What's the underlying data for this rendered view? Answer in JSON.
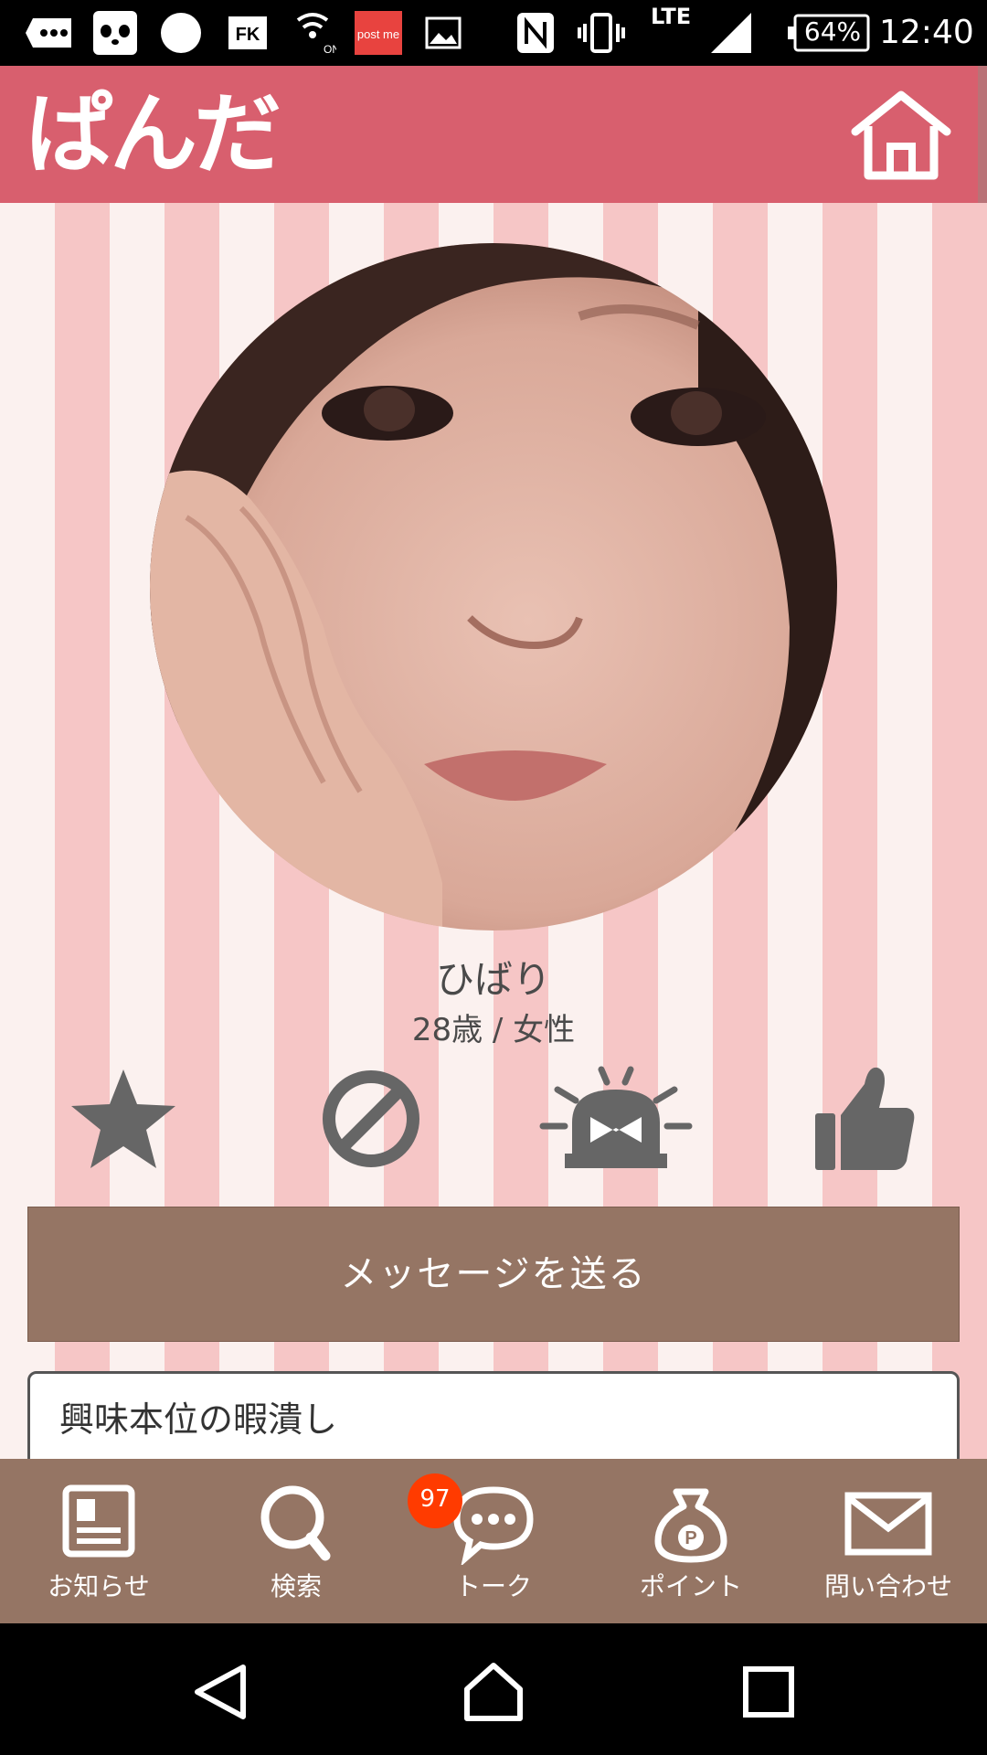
{
  "status_bar": {
    "battery": "64%",
    "time": "12:40",
    "network": "LTE",
    "icons": [
      "more-notifications-icon",
      "panda-app-icon",
      "circle-icon",
      "fk-app-icon",
      "wifi-calling-on-icon",
      "postme-app-icon",
      "image-icon",
      "nfc-icon",
      "vibrate-icon",
      "signal-icon",
      "battery-icon"
    ]
  },
  "header": {
    "logo": "ぱんだ",
    "home_icon": "home-icon",
    "color": "#d85f6e"
  },
  "profile": {
    "name": "ひばり",
    "meta": "28歳 / 女性",
    "actions": [
      "star-icon",
      "block-icon",
      "report-siren-icon",
      "thumbs-up-icon"
    ],
    "message_button": "メッセージを送る",
    "bio": "興味本位の暇潰し"
  },
  "bottom_nav": {
    "items": [
      {
        "label": "お知らせ",
        "icon": "news-icon"
      },
      {
        "label": "検索",
        "icon": "search-icon"
      },
      {
        "label": "トーク",
        "icon": "chat-bubble-icon"
      },
      {
        "label": "ポイント",
        "icon": "point-bag-icon"
      },
      {
        "label": "問い合わせ",
        "icon": "mail-icon"
      }
    ],
    "talk_badge": "97",
    "color": "#957564"
  },
  "system_nav": {
    "icons": [
      "back-icon",
      "home-nav-icon",
      "recents-icon"
    ]
  }
}
